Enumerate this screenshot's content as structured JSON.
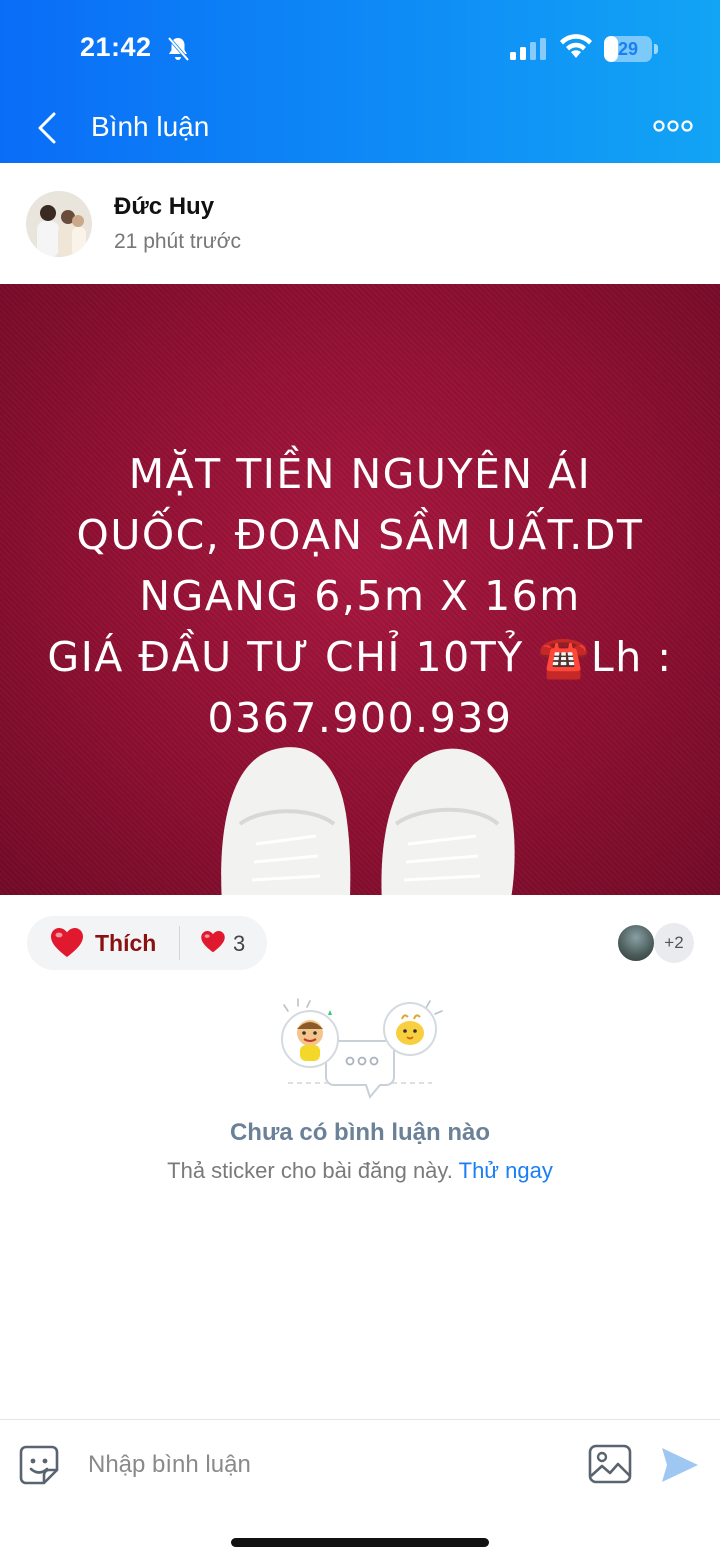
{
  "status_bar": {
    "time": "21:42",
    "battery": "29",
    "battery_level": 0.29
  },
  "header": {
    "title": "Bình luận"
  },
  "post": {
    "author_name": "Đức Huy",
    "time_ago": "21 phút trước",
    "image_text_lines": [
      "MẶT TIỀN NGUYÊN ÁI",
      "QUỐC, ĐOẠN SẦM UẤT.DT",
      "NGANG 6,5m X 16m",
      "GIÁ ĐẦU TƯ CHỈ 10TỶ ☎️Lh :",
      "0367.900.939"
    ]
  },
  "reactions": {
    "like_label": "Thích",
    "count": "3",
    "more_likers": "+2"
  },
  "comments": {
    "empty_title": "Chưa có bình luận nào",
    "empty_subtitle": "Thả sticker cho bài đăng này.",
    "try_link": "Thử ngay"
  },
  "composer": {
    "placeholder": "Nhập bình luận"
  },
  "colors": {
    "header_start": "#0a6df7",
    "header_end": "#12a4f5",
    "like_heart": "#e0192f",
    "link": "#1a7ef5"
  }
}
